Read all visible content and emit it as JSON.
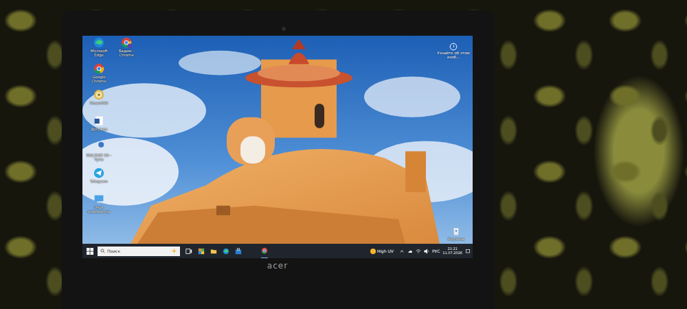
{
  "desktop_icons": [
    {
      "label": "Microsoft Edge",
      "kind": "edge"
    },
    {
      "label": "Вадим - Chrome",
      "kind": "chrome-profile"
    },
    {
      "label": "Google Chrome",
      "kind": "chrome"
    },
    {
      "label": "PowerISO",
      "kind": "poweriso"
    },
    {
      "label": "Договор",
      "kind": "word"
    },
    {
      "label": "ЮЦ ЕЦК 10 - Тула",
      "kind": "help"
    },
    {
      "label": "Telegram",
      "kind": "telegram"
    },
    {
      "label": "Этот компьютер",
      "kind": "pc"
    }
  ],
  "spotlight": {
    "label": "Узнайте об этом изоб..."
  },
  "recycle_bin": {
    "label": "Корзина"
  },
  "taskbar": {
    "search_placeholder": "Поиск",
    "apps": [
      {
        "kind": "task-view"
      },
      {
        "kind": "widgets"
      },
      {
        "kind": "explorer"
      },
      {
        "kind": "edge"
      },
      {
        "kind": "store"
      },
      {
        "kind": "chrome"
      }
    ],
    "weather": "High UV",
    "tray_icons": [
      {
        "kind": "chevron"
      },
      {
        "kind": "cloud"
      },
      {
        "kind": "network"
      },
      {
        "kind": "volume"
      }
    ],
    "language": "РУС",
    "time": "21:21",
    "date": "11.07.2026"
  },
  "brand": "acer"
}
